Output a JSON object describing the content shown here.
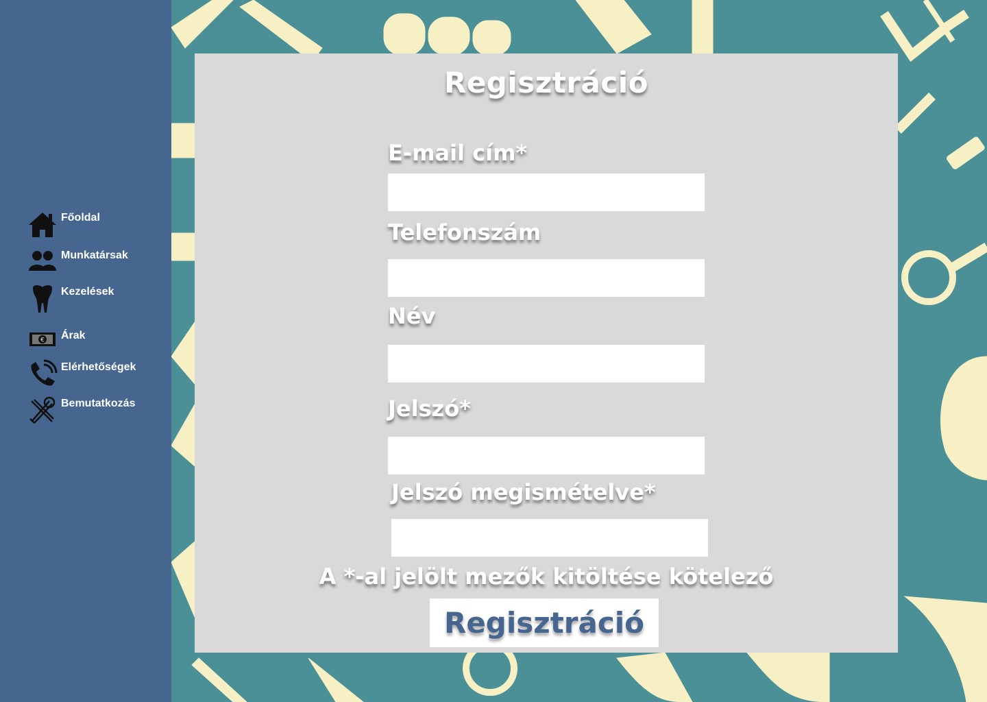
{
  "sidebar": {
    "items": [
      {
        "label": "Főoldal",
        "icon": "home-icon"
      },
      {
        "label": "Munkatársak",
        "icon": "people-icon"
      },
      {
        "label": "Kezelések",
        "icon": "tooth-icon"
      },
      {
        "label": "Árak",
        "icon": "euro-banknote-icon"
      },
      {
        "label": "Elérhetőségek",
        "icon": "phone-icon"
      },
      {
        "label": "Bemutatkozás",
        "icon": "tools-icon"
      }
    ]
  },
  "form": {
    "title": "Regisztráció",
    "fields": [
      {
        "label": "E-mail cím*",
        "value": "",
        "placeholder": ""
      },
      {
        "label": "Telefonszám",
        "value": "",
        "placeholder": ""
      },
      {
        "label": "Név",
        "value": "",
        "placeholder": ""
      },
      {
        "label": "Jelszó*",
        "value": "",
        "placeholder": ""
      },
      {
        "label": "Jelszó megismételve*",
        "value": "",
        "placeholder": ""
      }
    ],
    "required_note": "A *-al jelölt mezők kitöltése kötelező",
    "submit_label": "Regisztráció"
  },
  "colors": {
    "sidebar": "#46658f",
    "background": "#4a9096",
    "pattern": "#f6f0c4",
    "panel": "#d9d9d9",
    "button_text": "#46658f"
  }
}
